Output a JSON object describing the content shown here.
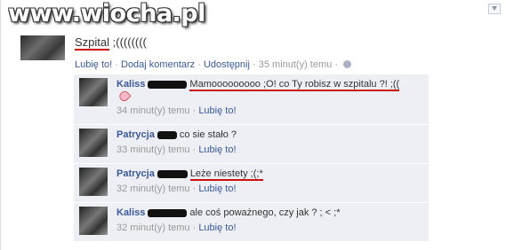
{
  "watermark": "www.wiocha.pl",
  "post": {
    "text_underlined": "Szpital",
    "text_rest": " ;((((((((",
    "actions": {
      "like": "Lubię to!",
      "comment": "Dodaj komentarz",
      "share": "Udostępnij",
      "time": "35 minut(y) temu"
    }
  },
  "comments": [
    {
      "author": "Kaliss",
      "text": "Mamooooooooo ;O! co Ty robisz w szpitalu ?! ;((",
      "time": "34 minut(y) temu",
      "like": "Lubię to!"
    },
    {
      "author": "Patrycja",
      "text": "co sie stało ?",
      "time": "33 minut(y) temu",
      "like": "Lubię to!"
    },
    {
      "author": "Patrycja",
      "text": "Leże niestety ;(;*",
      "time": "32 minut(y) temu",
      "like": "Lubię to!"
    },
    {
      "author": "Kaliss",
      "text": "ale coś poważnego, czy jak ? ; < ;*",
      "time": "32 minut(y) temu",
      "like": "Lubię to!"
    }
  ],
  "separator": " · "
}
